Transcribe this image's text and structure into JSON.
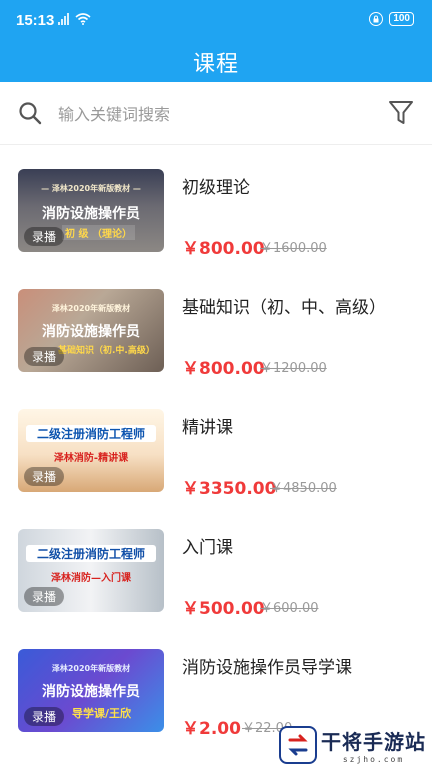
{
  "status_bar": {
    "time": "15:13",
    "battery": "100"
  },
  "header": {
    "title": "课程"
  },
  "search": {
    "placeholder": "输入关键词搜索",
    "value": ""
  },
  "colors": {
    "primary": "#1fa4f2",
    "price": "#f03a3a",
    "original_price": "#9a9a9a"
  },
  "courses": [
    {
      "name": "初级理论",
      "price": "￥800.00",
      "original_price": "￥1600.00",
      "tag": "录播",
      "thumb_top": "— 泽林2020年新版教材 —",
      "thumb_main": "消防设施操作员",
      "thumb_sub": "初 级 （理论）"
    },
    {
      "name": "基础知识（初、中、高级）",
      "price": "￥800.00",
      "original_price": "￥1200.00",
      "tag": "录播",
      "thumb_top": "泽林2020年新版教材",
      "thumb_main": "消防设施操作员",
      "thumb_sub": "基础知识（初.中.高级）"
    },
    {
      "name": "精讲课",
      "price": "￥3350.00",
      "original_price": "￥4850.00",
      "tag": "录播",
      "thumb_top": "",
      "thumb_main": "二级注册消防工程师",
      "thumb_sub": "泽林消防-精讲课"
    },
    {
      "name": "入门课",
      "price": "￥500.00",
      "original_price": "￥600.00",
      "tag": "录播",
      "thumb_top": "",
      "thumb_main": "二级注册消防工程师",
      "thumb_sub": "泽林消防—入门课"
    },
    {
      "name": "消防设施操作员导学课",
      "price": "￥2.00",
      "original_price": "￥22.00",
      "tag": "录播",
      "thumb_top": "泽林2020年新版教材",
      "thumb_main": "消防设施操作员",
      "thumb_sub": "导学课/王欣"
    }
  ],
  "watermark": {
    "name": "干将手游站",
    "domain": "szjho.com"
  }
}
